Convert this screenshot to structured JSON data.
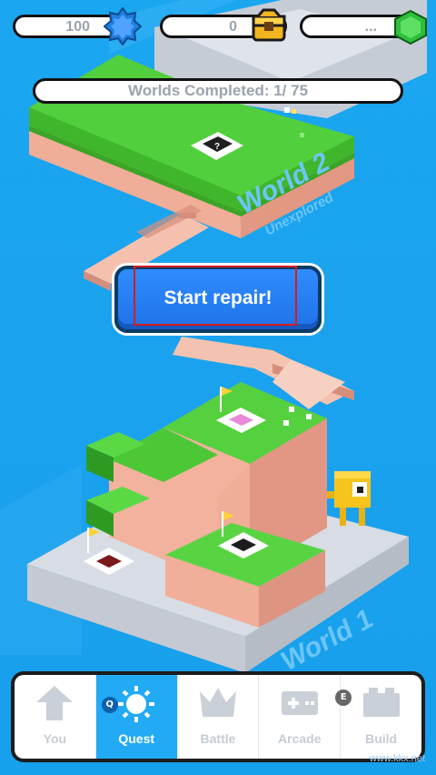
{
  "resources": {
    "stars": "100",
    "chests": "0",
    "gems": "..."
  },
  "progress_text": "Worlds Completed: 1/ 75",
  "world2": {
    "title": "World 2",
    "subtitle": "Unexplored"
  },
  "world1": {
    "title": "World 1"
  },
  "repair_button": "Start repair!",
  "nav": {
    "items": [
      {
        "label": "You",
        "icon": "arrow-up-icon"
      },
      {
        "label": "Quest",
        "icon": "sun-icon",
        "badge": "Q"
      },
      {
        "label": "Battle",
        "icon": "crown-icon"
      },
      {
        "label": "Arcade",
        "icon": "gamepad-icon"
      },
      {
        "label": "Build",
        "icon": "brick-icon",
        "badge": "E"
      }
    ]
  },
  "watermark": "www.kkx.net",
  "colors": {
    "sky": "#1aa7f0",
    "button": "#2f8cff",
    "grass": "#4fcf3a",
    "dirt": "#f1b29d",
    "stone": "#d7dbe3",
    "active_tab": "#22aaf5"
  }
}
